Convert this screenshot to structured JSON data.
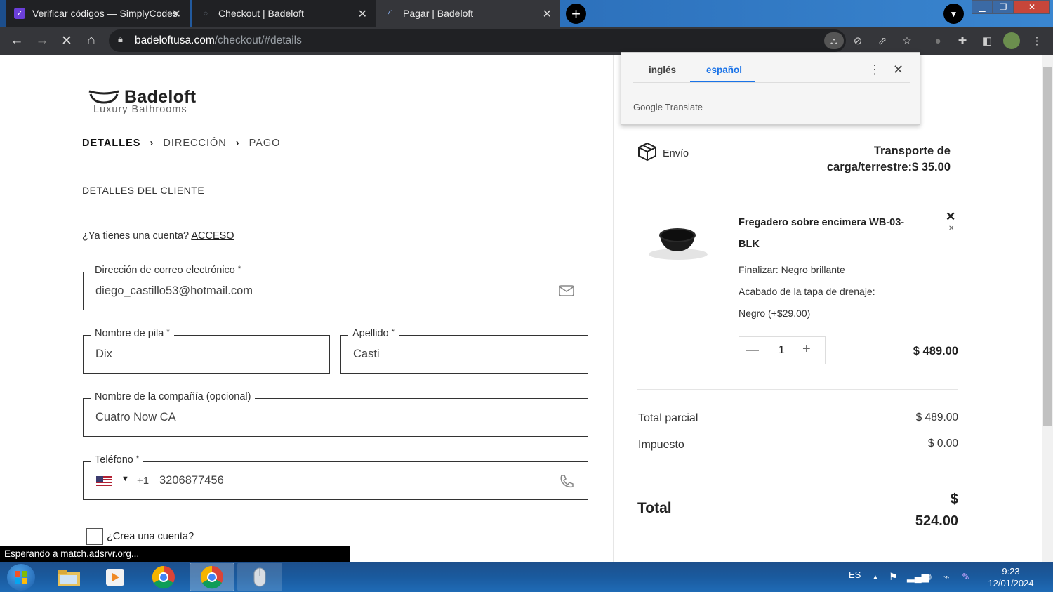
{
  "browser": {
    "tabs": [
      {
        "title": "Verificar códigos — SimplyCodes"
      },
      {
        "title": "Checkout | Badeloft"
      },
      {
        "title": "Pagar | Badeloft"
      }
    ],
    "url_domain": "badeloftusa.com",
    "url_path": "/checkout/#details",
    "status_text": "Esperando a match.adsrvr.org..."
  },
  "translate_popup": {
    "tab_source": "inglés",
    "tab_target": "español",
    "brand": "Google Translate"
  },
  "checkout": {
    "logo_name": "Badeloft",
    "logo_tagline": "Luxury Bathrooms",
    "steps": [
      "DETALLES",
      "DIRECCIÓN",
      "PAGO"
    ],
    "section_title": "DETALLES DEL CLIENTE",
    "account_question": "¿Ya tienes una cuenta?",
    "account_link": "ACCESO",
    "fields": {
      "email_label": "Dirección de correo electrónico",
      "email_value": "diego_castillo53@hotmail.com",
      "first_name_label": "Nombre de pila",
      "first_name_value": "Dix",
      "last_name_label": "Apellido",
      "last_name_value": "Casti",
      "company_label": "Nombre de la compañía (opcional)",
      "company_value": "Cuatro Now CA",
      "phone_label": "Teléfono",
      "phone_country_code": "+1",
      "phone_value": "3206877456",
      "required_mark": "*"
    },
    "create_account_label": "¿Crea una cuenta?"
  },
  "order_summary": {
    "shipping_label": "Envío",
    "shipping_value": "Transporte de carga/terrestre:$ 35.00",
    "product_name": "Fregadero sobre encimera WB-03-BLK",
    "product_options": [
      "Finalizar: Negro brillante",
      "Acabado de la tapa de drenaje:",
      "Negro (+$29.00)"
    ],
    "quantity": "1",
    "item_price": "$ 489.00",
    "subtotal_label": "Total parcial",
    "subtotal_value": "$ 489.00",
    "tax_label": "Impuesto",
    "tax_value": "$ 0.00",
    "total_label": "Total",
    "total_currency": "$",
    "total_value": "524.00"
  },
  "taskbar": {
    "language": "ES",
    "time": "9:23",
    "date": "12/01/2024"
  }
}
